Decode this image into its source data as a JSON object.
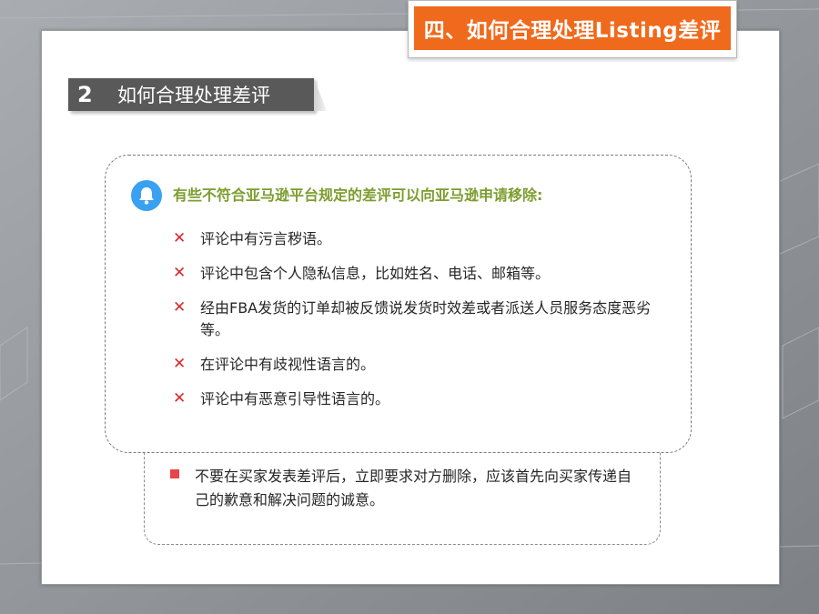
{
  "title_banner": "四、如何合理处理Listing差评",
  "section": {
    "number": "2",
    "title": "如何合理处理差评"
  },
  "main_box": {
    "heading": "有些不符合亚马逊平台规定的差评可以向亚马逊申请移除:",
    "heading_icon": "bell-icon",
    "bullet_icon": "x-icon",
    "items": [
      "评论中有污言秽语。",
      "评论中包含个人隐私信息，比如姓名、电话、邮箱等。",
      "经由FBA发货的订单却被反馈说发货时效差或者派送人员服务态度恶劣等。",
      "在评论中有歧视性语言的。",
      "评论中有恶意引导性语言的。"
    ]
  },
  "lower_box": {
    "bullet_icon": "red-square-bullet",
    "text": "不要在买家发表差评后，立即要求对方删除，应该首先向买家传递自己的歉意和解决问题的诚意。"
  },
  "colors": {
    "banner": "#ef6a1c",
    "section_header": "#595959",
    "heading_text": "#7d9d2f",
    "x_mark": "#d9282e",
    "square_bullet": "#e8454a",
    "bell": "#3aa0f2"
  }
}
